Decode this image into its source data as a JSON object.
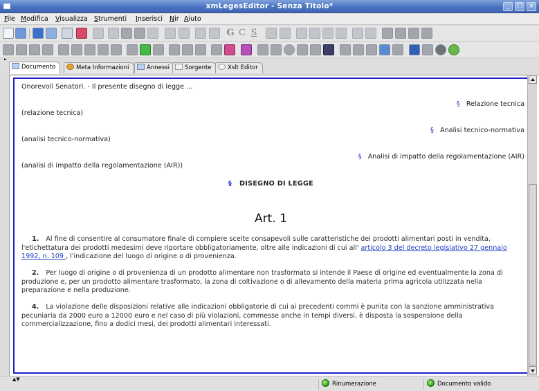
{
  "window": {
    "title": "xmLegesEditor - Senza Titolo*"
  },
  "menu": {
    "items": [
      {
        "label": "File",
        "u": "F"
      },
      {
        "label": "Modifica",
        "u": "M"
      },
      {
        "label": "Visualizza",
        "u": "V"
      },
      {
        "label": "Strumenti",
        "u": "S"
      },
      {
        "label": "Inserisci",
        "u": "I"
      },
      {
        "label": "Nir",
        "u": "N"
      },
      {
        "label": "Aiuto",
        "u": "A"
      }
    ]
  },
  "toolbar1": {
    "text_buttons": [
      "G",
      "C",
      "S"
    ]
  },
  "tabs": [
    {
      "label": "Documento",
      "icon": "document-icon"
    },
    {
      "label": "Meta Informazioni",
      "icon": "meta-icon"
    },
    {
      "label": "Annessi",
      "icon": "attachments-icon"
    },
    {
      "label": "Sorgente",
      "icon": "source-icon"
    },
    {
      "label": "Xslt Editor",
      "icon": "xslt-icon"
    }
  ],
  "document": {
    "intro": "Onorevoli Senatori. - Il presente disegno di legge ...",
    "section_mark": "§",
    "relazione_tecnica_heading": "Relazione tecnica",
    "relazione_tecnica_placeholder": "(relazione tecnica)",
    "analisi_tn_heading": "Analisi tecnico-normativa",
    "analisi_tn_placeholder": "(analisi tecnico-normativa)",
    "air_heading": "Analisi di impatto della regolamentazione (AIR)",
    "air_placeholder": "(analisi di impatto della regolamentazione (AIR))",
    "ddl_heading": "DISEGNO DI LEGGE",
    "article_title": "Art. 1",
    "paragraphs": [
      {
        "num": "1.",
        "text_before": "Al fine di consentire al consumatore finale di compiere scelte consapevoli sulle caratteristiche dei prodotti alimentari posti in vendita, l'etichettatura dei prodotti medesimi deve riportare obbligatoriamente, oltre alle indicazioni di cui all'",
        "link": " articolo 3 del decreto legislativo 27 gennaio 1992, n. 109 ",
        "text_after": ", l'indicazione del luogo di origine o di provenienza."
      },
      {
        "num": "2.",
        "text_before": "Per luogo di origine o di provenienza di un prodotto alimentare non trasformato si intende il Paese di origine ed eventualmente la zona di produzione e, per un prodotto alimentare trasformato, la zona di coltivazione o di allevamento della materia prima agricola utilizzata nella preparazione e nella produzione."
      },
      {
        "num": "4.",
        "text_before": "La violazione delle disposizioni relative alle indicazioni obbligatorie di cui ai precedenti commi è punita con la sanzione amministrativa pecuniaria da 2000 euro a 12000 euro e nel caso di più violazioni, commesse anche in tempi diversi, è disposta la sospensione della commercializzazione, fino a dodici mesi, dei prodotti alimentari interessati."
      }
    ]
  },
  "status": {
    "renumbering": "Rinumerazione",
    "valid": "Documento valido"
  }
}
